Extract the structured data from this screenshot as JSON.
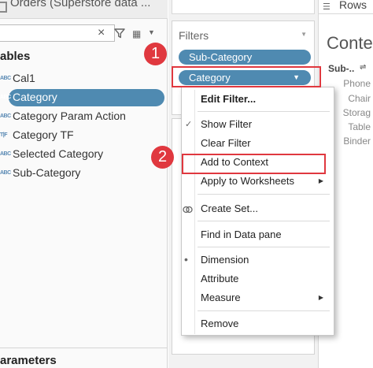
{
  "data_pane": {
    "datasource_title": "Orders (Superstore data ...",
    "search_clear": "×",
    "section_tables": "ables",
    "fields": [
      {
        "type": "ABC",
        "name": "Cal1",
        "selected": false
      },
      {
        "type": "ABC",
        "name": "Category",
        "selected": true
      },
      {
        "type": "ABC",
        "name": "Category Param Action",
        "selected": false
      },
      {
        "type": "T|F",
        "name": "Category TF",
        "selected": false
      },
      {
        "type": "ABC",
        "name": "Selected Category",
        "selected": false
      },
      {
        "type": "ABC",
        "name": "Sub-Category",
        "selected": false
      }
    ],
    "section_parameters": "arameters"
  },
  "shelves": {
    "filters_title": "Filters",
    "filter_pills": [
      {
        "label": "Sub-Category"
      },
      {
        "label": "Category"
      }
    ],
    "rows_label": "Rows"
  },
  "canvas": {
    "title": "Conte",
    "column_header": "Sub-..",
    "rows": [
      "Phone",
      "Chair",
      "Storag",
      "Table",
      "Binder"
    ]
  },
  "context_menu": {
    "items": [
      {
        "label": "Edit Filter...",
        "bold": true
      },
      {
        "label": "Show Filter",
        "checked": true
      },
      {
        "label": "Clear Filter"
      },
      {
        "label": "Add to Context"
      },
      {
        "label": "Apply to Worksheets",
        "submenu": true
      },
      {
        "label": "Create Set...",
        "icon": "create-set-icon"
      },
      {
        "label": "Find in Data pane"
      },
      {
        "label": "Dimension",
        "radio_selected": true
      },
      {
        "label": "Attribute"
      },
      {
        "label": "Measure",
        "submenu": true
      },
      {
        "label": "Remove"
      }
    ],
    "check_mark": "✓",
    "bullet_mark": "•"
  },
  "annotations": {
    "step1": "1",
    "step2": "2",
    "highlight_color": "#e0383f"
  },
  "colors": {
    "pill_blue": "#4f8ab1",
    "field_type_blue": "#5a8ab4"
  }
}
